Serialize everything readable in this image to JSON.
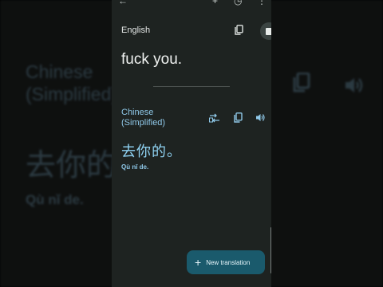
{
  "background": {
    "target_lang": "Chinese\n(Simplified)",
    "translated_text": "去你的",
    "romanization": "Qù nǐ de."
  },
  "source": {
    "language": "English",
    "text": "fuck you."
  },
  "target": {
    "language_line1": "Chinese",
    "language_line2": "(Simplified)",
    "translated_text": "去你的。",
    "romanization": "Qù nǐ de."
  },
  "fab": {
    "label": "New translation"
  },
  "icons": {
    "back": "back-arrow-icon",
    "add": "plus-icon",
    "history": "history-icon",
    "more": "more-vert-icon",
    "copy": "copy-icon",
    "stop": "stop-icon",
    "swap": "swap-icon",
    "speaker": "speaker-icon"
  }
}
